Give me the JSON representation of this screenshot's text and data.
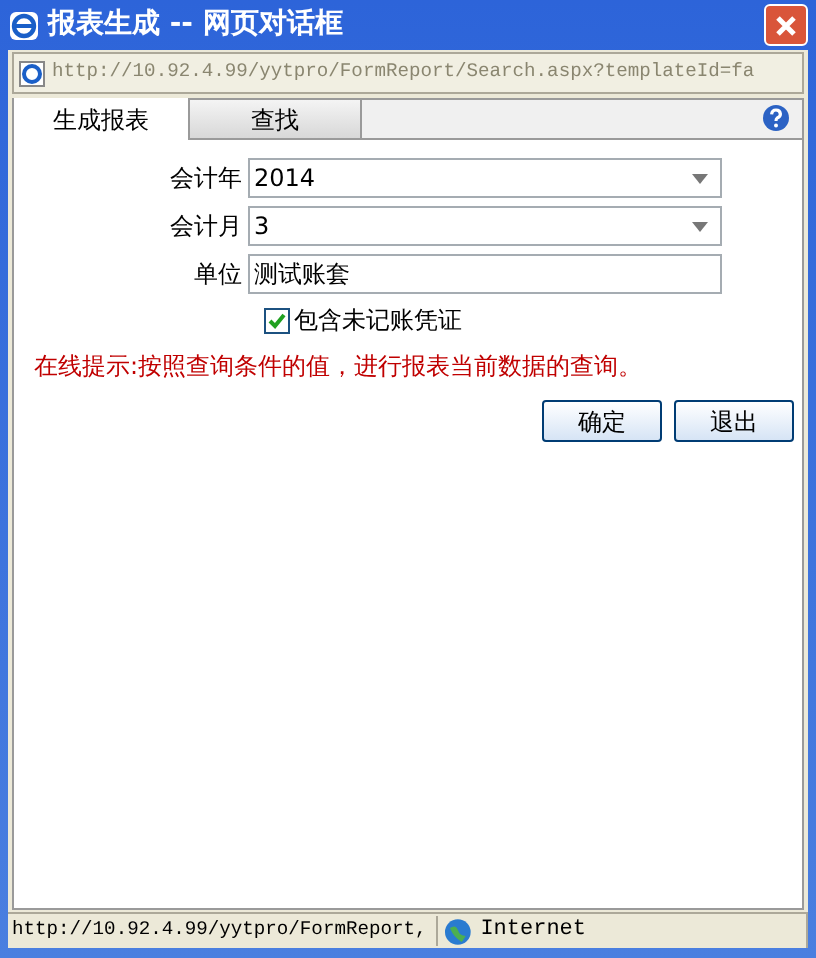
{
  "window": {
    "title": "报表生成 -- 网页对话框"
  },
  "address_bar": {
    "url": "http://10.92.4.99/yytpro/FormReport/Search.aspx?templateId=fa"
  },
  "tabs": [
    {
      "label": "生成报表",
      "selected": true
    },
    {
      "label": "查找",
      "selected": false
    }
  ],
  "form": {
    "fields": [
      {
        "kind": "select",
        "label": "会计年",
        "value": "2014"
      },
      {
        "kind": "select",
        "label": "会计月",
        "value": "3"
      },
      {
        "kind": "text",
        "label": "单位",
        "value": "测试账套"
      }
    ],
    "checkbox": {
      "label": "包含未记账凭证",
      "checked": true
    },
    "hint": "在线提示:按照查询条件的值，进行报表当前数据的查询。"
  },
  "buttons": [
    "确定",
    "退出"
  ],
  "status_bar": {
    "url": "http://10.92.4.99/yytpro/FormReport,",
    "zone": "Internet"
  }
}
